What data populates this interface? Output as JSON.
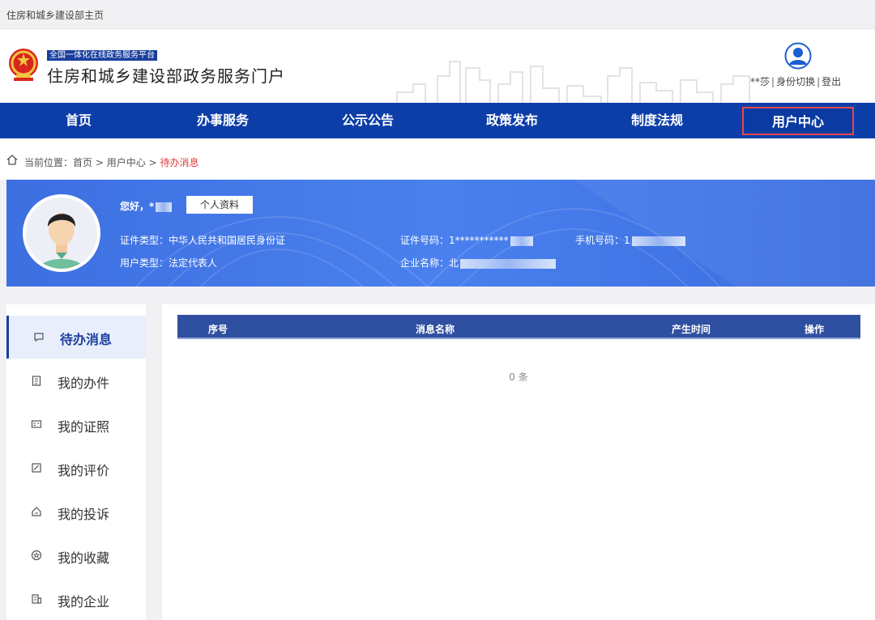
{
  "topbar": {
    "home_link": "住房和城乡建设部主页"
  },
  "header": {
    "tagline": "全国一体化在线政务服务平台",
    "title": "住房和城乡建设部政务服务门户",
    "user": {
      "name": "**莎",
      "switch_label": "身份切换",
      "logout_label": "登出",
      "separator": "|"
    }
  },
  "nav": [
    {
      "label": "首页"
    },
    {
      "label": "办事服务"
    },
    {
      "label": "公示公告"
    },
    {
      "label": "政策发布"
    },
    {
      "label": "制度法规"
    },
    {
      "label": "用户中心",
      "active": true
    }
  ],
  "breadcrumb": {
    "prefix": "当前位置：",
    "home": "首页",
    "sep": ">",
    "section": "用户中心",
    "current": "待办消息"
  },
  "profile": {
    "greeting": "您好，",
    "greeting_name": "*",
    "profile_button": "个人资料",
    "cert_type_label": "证件类型：",
    "cert_type_value": "中华人民共和国居民身份证",
    "user_type_label": "用户类型：",
    "user_type_value": "法定代表人",
    "cert_no_label": "证件号码：",
    "cert_no_value": "1***********",
    "company_label": "企业名称：",
    "company_value": "北",
    "phone_label": "手机号码：",
    "phone_value": "1"
  },
  "sidebar": [
    {
      "label": "待办消息",
      "icon": "message-icon",
      "active": true
    },
    {
      "label": "我的办件",
      "icon": "clipboard-icon"
    },
    {
      "label": "我的证照",
      "icon": "id-card-icon"
    },
    {
      "label": "我的评价",
      "icon": "edit-note-icon"
    },
    {
      "label": "我的投诉",
      "icon": "complaint-icon"
    },
    {
      "label": "我的收藏",
      "icon": "star-icon"
    },
    {
      "label": "我的企业",
      "icon": "building-icon"
    }
  ],
  "table": {
    "columns": [
      "序号",
      "消息名称",
      "产生时间",
      "操作"
    ],
    "empty_text": "0 条"
  },
  "colors": {
    "nav_bg": "#0d3ea8",
    "accent": "#1a3e9e",
    "active_border": "#e54a4a",
    "banner": "#3f73e3"
  }
}
